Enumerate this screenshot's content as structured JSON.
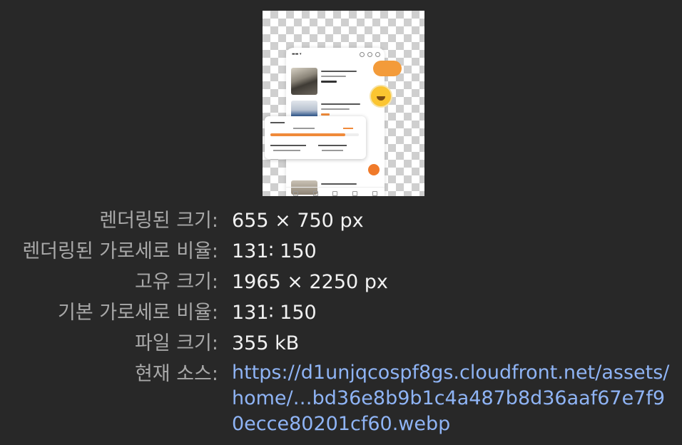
{
  "preview": {
    "image_icon": "image-thumbnail-transparent-checkerboard"
  },
  "info": {
    "rendered_size_label": "렌더링된 크기:",
    "rendered_size_value": "655 × 750 px",
    "rendered_ratio_label": "렌더링된 가로세로 비율:",
    "rendered_ratio_value": "131∶ 150",
    "intrinsic_size_label": "고유 크기:",
    "intrinsic_size_value": "1965 × 2250 px",
    "intrinsic_ratio_label": "기본 가로세로 비율:",
    "intrinsic_ratio_value": "131∶ 150",
    "file_size_label": "파일 크기:",
    "file_size_value": "355 kB",
    "current_source_label": "현재 소스:",
    "current_source_value": "https://d1unjqcospf8gs.cloudfront.net/assets/home/…bd36e8b9b1c4a487b8d36aaf67e7f90ecce80201cf60.webp"
  },
  "colors": {
    "background": "#282828",
    "label": "#a8a8a8",
    "value": "#f2f2f2",
    "link": "#8fb4f5"
  }
}
